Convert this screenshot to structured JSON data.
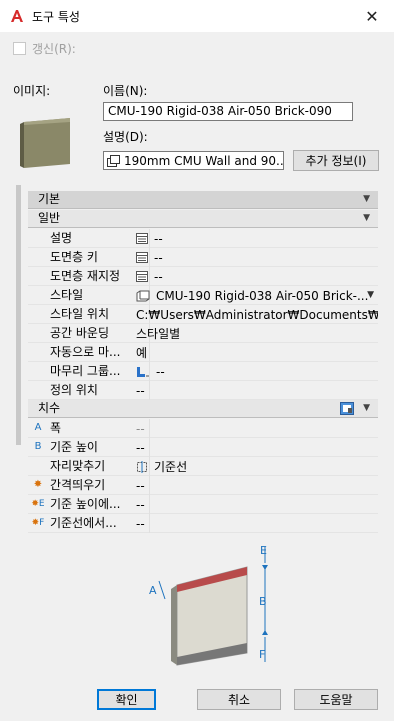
{
  "window": {
    "title": "도구 특성",
    "close": "✕"
  },
  "refresh_label": "갱신(R):",
  "image_label": "이미지:",
  "name_label": "이름(N):",
  "name_value": "CMU-190 Rigid-038 Air-050 Brick-090",
  "desc_label": "설명(D):",
  "desc_value": "190mm CMU Wall and 90...",
  "more_info_button": "추가 정보(I)",
  "categories": {
    "basic": "기본",
    "general": "일반",
    "dimension": "치수"
  },
  "general_rows": [
    {
      "name": "설명",
      "value": "--"
    },
    {
      "name": "도면층 키",
      "value": "--"
    },
    {
      "name": "도면층 재지정",
      "value": "--"
    },
    {
      "name": "스타일",
      "value": "CMU-190 Rigid-038 Air-050 Brick-..."
    },
    {
      "name": "스타일 위치",
      "value": "C:₩Users₩Administrator₩Documents₩A..."
    },
    {
      "name": "공간 바운딩",
      "value": "스타일별"
    },
    {
      "name": "자동으로 마...",
      "value": "예"
    },
    {
      "name": "마무리 그룹...",
      "value": "--"
    },
    {
      "name": "정의 위치",
      "value": "--"
    }
  ],
  "dimension_rows": [
    {
      "key": "A",
      "name": "폭",
      "value": "--"
    },
    {
      "key": "B",
      "name": "기준 높이",
      "value": "--"
    },
    {
      "key": "",
      "name": "자리맞추기",
      "value": "기준선"
    },
    {
      "key": "",
      "name": "간격띄우기",
      "value": "--"
    },
    {
      "key": "E",
      "name": "기준 높이에...",
      "value": "--"
    },
    {
      "key": "F",
      "name": "기준선에서...",
      "value": "--"
    }
  ],
  "diagram_labels": {
    "a": "A",
    "b": "B",
    "e": "E",
    "f": "F"
  },
  "buttons": {
    "ok": "확인",
    "cancel": "취소",
    "help": "도움말"
  }
}
